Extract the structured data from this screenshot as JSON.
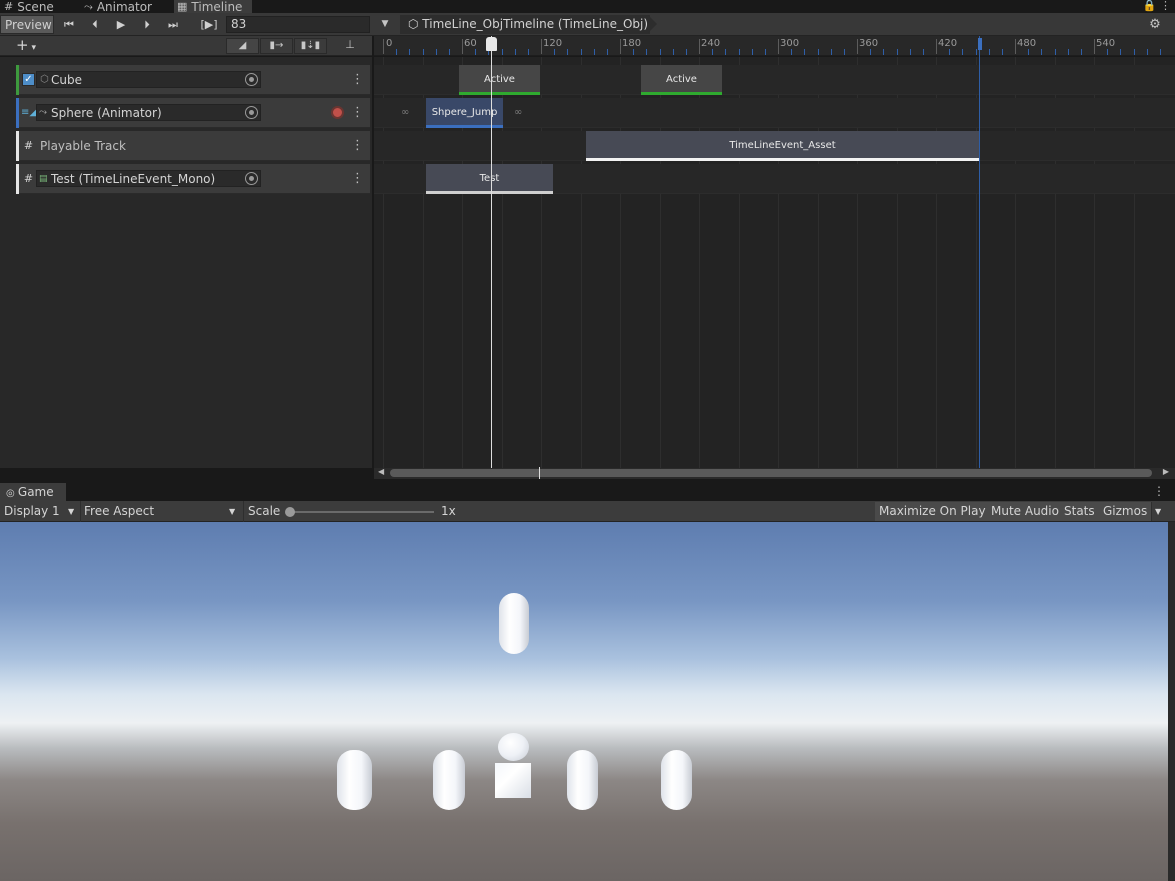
{
  "tabs": [
    {
      "icon": "#",
      "label": "Scene"
    },
    {
      "icon": "⤳",
      "label": "Animator"
    },
    {
      "icon": "▦",
      "label": "Timeline"
    }
  ],
  "toolbar": {
    "preview_label": "Preview",
    "current_frame": "83",
    "frame_toggle": "[▶]",
    "breadcrumb": "TimeLine_ObjTimeline (TimeLine_Obj)"
  },
  "ruler": {
    "labels": [
      "0",
      "60",
      "120",
      "180",
      "240",
      "300",
      "360",
      "420",
      "480",
      "540"
    ]
  },
  "tracks": [
    {
      "name": "Cube",
      "color": "#3e9a3e",
      "type": "activation"
    },
    {
      "name": "Sphere (Animator)",
      "color": "#3b6fbf",
      "type": "animation"
    },
    {
      "name": "Playable Track",
      "color": "#e6e6e6",
      "type": "playable"
    },
    {
      "name": "Test (TimeLineEvent_Mono)",
      "color": "#e6e6e6",
      "type": "script"
    }
  ],
  "clips": {
    "cube_1": "Active",
    "cube_2": "Active",
    "sphere": "Shpere_Jump",
    "playable": "TimeLineEvent_Asset",
    "test": "Test"
  },
  "game": {
    "tab_label": "Game",
    "display": "Display 1",
    "aspect": "Free Aspect",
    "scale_label": "Scale",
    "scale_value": "1x",
    "buttons": [
      "Maximize On Play",
      "Mute Audio",
      "Stats",
      "Gizmos"
    ]
  }
}
